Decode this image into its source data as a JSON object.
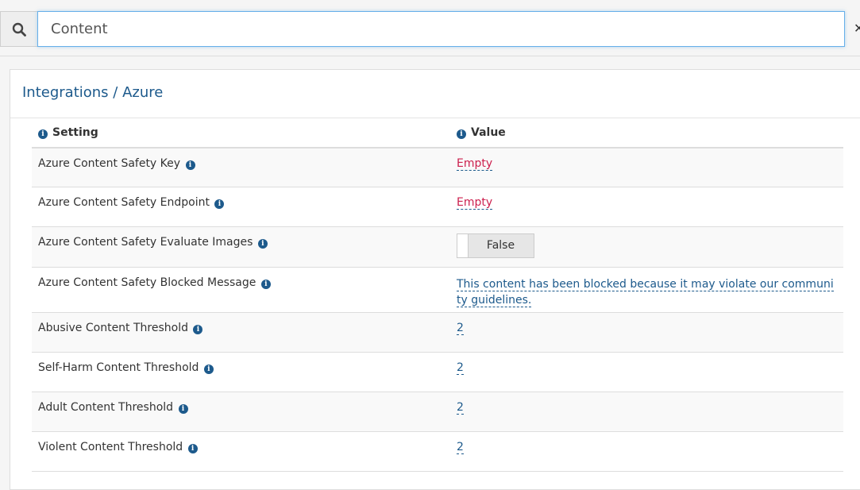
{
  "search": {
    "value": "Content"
  },
  "panel": {
    "title": "Integrations / Azure",
    "headers": {
      "setting": "Setting",
      "value": "Value"
    },
    "rows": [
      {
        "label": "Azure Content Safety Key",
        "value": "Empty",
        "kind": "empty",
        "height": 49
      },
      {
        "label": "Azure Content Safety Endpoint",
        "value": "Empty",
        "kind": "empty",
        "height": 50
      },
      {
        "label": "Azure Content Safety Evaluate Images",
        "value": "False",
        "kind": "toggle",
        "height": 51
      },
      {
        "label": "Azure Content Safety Blocked Message",
        "value": "This content has been blocked because it may violate our community guidelines.",
        "kind": "text",
        "height": 57
      },
      {
        "label": "Abusive Content Threshold",
        "value": "2",
        "kind": "number",
        "height": 50
      },
      {
        "label": "Self-Harm Content Threshold",
        "value": "2",
        "kind": "number",
        "height": 50
      },
      {
        "label": "Adult Content Threshold",
        "value": "2",
        "kind": "number",
        "height": 50
      },
      {
        "label": "Violent Content Threshold",
        "value": "2",
        "kind": "number",
        "height": 50
      }
    ]
  },
  "icons": {
    "search": "search-icon",
    "info": "info-icon"
  },
  "colors": {
    "link": "#1d5a8c",
    "empty": "#cc1f4d",
    "focus": "#66afe9"
  }
}
